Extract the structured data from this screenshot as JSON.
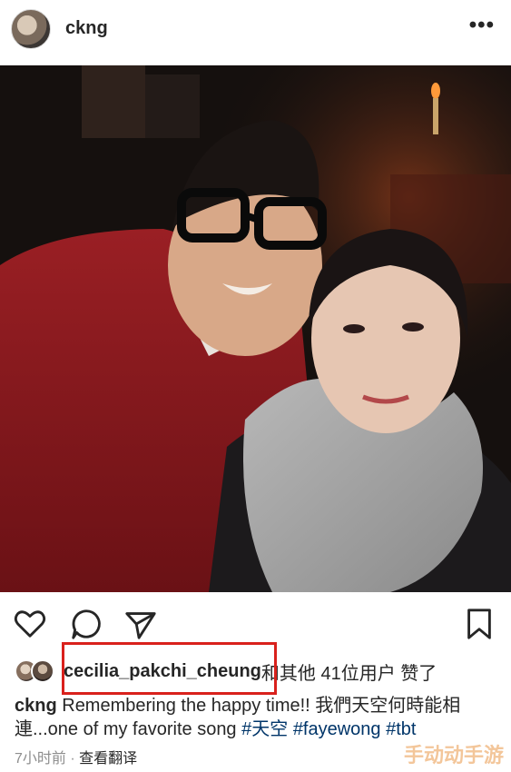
{
  "post": {
    "username": "ckng",
    "more_label": "•••"
  },
  "icons": {
    "like": "heart-icon",
    "comment": "comment-icon",
    "share": "send-icon",
    "save": "bookmark-icon"
  },
  "likes": {
    "liked_by": "cecilia_pakchi_cheung",
    "rest": "和其他 41位用户 赞了"
  },
  "caption": {
    "username": "ckng",
    "text": " Remembering the happy time!! 我們天空何時能相連...one of my favorite song ",
    "tags": [
      "#天空",
      "#fayewong",
      "#tbt"
    ]
  },
  "meta": {
    "time": "7小时前",
    "separator": " · ",
    "translate": "查看翻译"
  },
  "watermark": "手动动手游",
  "colors": {
    "highlight": "#d9211c",
    "hashtag": "#003569",
    "text": "#262626",
    "muted": "#8e8e8e"
  }
}
